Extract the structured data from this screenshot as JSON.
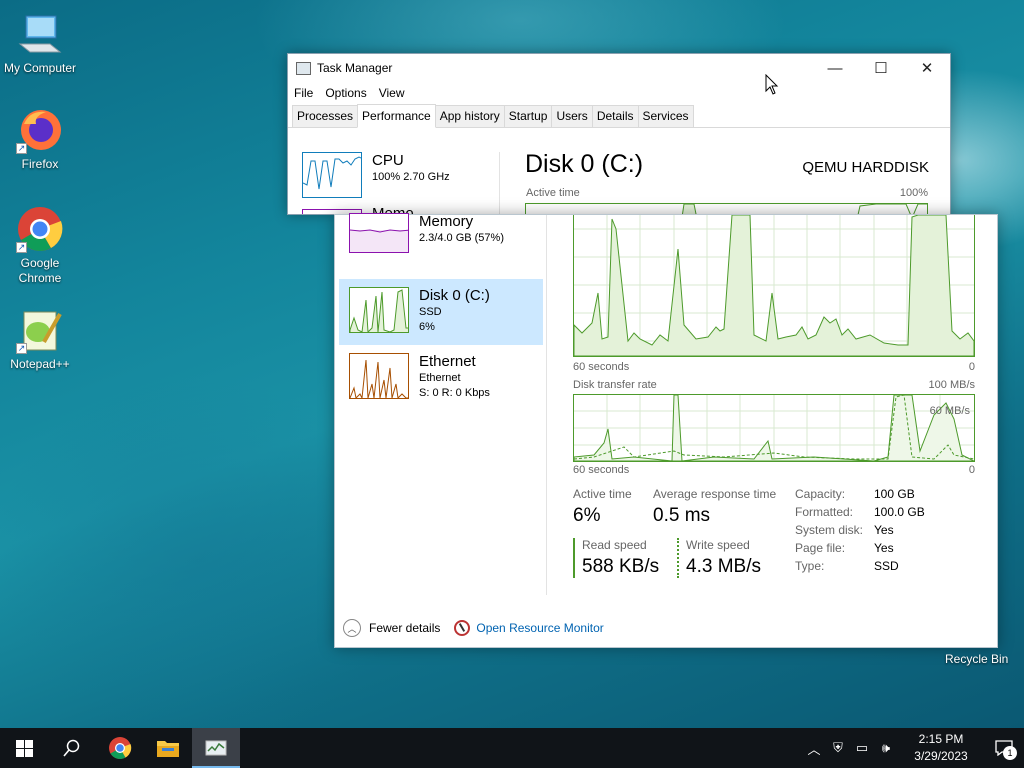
{
  "desktop": {
    "icons": [
      {
        "label": "My Computer"
      },
      {
        "label": "Firefox"
      },
      {
        "label": "Google Chrome"
      },
      {
        "label": "Notepad++"
      }
    ],
    "recycle_bin": "Recycle Bin"
  },
  "window": {
    "title": "Task Manager",
    "controls": {
      "minimize": "—",
      "maximize": "☐",
      "close": "✕"
    },
    "menu": [
      "File",
      "Options",
      "View"
    ],
    "tabs": [
      "Processes",
      "Performance",
      "App history",
      "Startup",
      "Users",
      "Details",
      "Services"
    ],
    "active_tab": "Performance"
  },
  "sidebar": {
    "cpu": {
      "name": "CPU",
      "sub": "100%  2.70 GHz"
    },
    "memory": {
      "name": "Memory",
      "sub": "2.3/4.0 GB (57%)",
      "name_partial": "Memo"
    },
    "disk": {
      "name": "Disk 0 (C:)",
      "sub1": "SSD",
      "sub2": "6%"
    },
    "ethernet": {
      "name": "Ethernet",
      "sub1": "Ethernet",
      "sub2": "S: 0  R: 0 Kbps"
    }
  },
  "detail": {
    "title": "Disk 0 (C:)",
    "model": "QEMU HARDDISK",
    "active_time_chart": {
      "label": "Active time",
      "max": "100%",
      "x_left": "60 seconds",
      "x_right": "0"
    },
    "transfer_chart": {
      "label": "Disk transfer rate",
      "max": "100 MB/s",
      "inline": "60 MB/s",
      "x_left": "60 seconds",
      "x_right": "0"
    },
    "stats": {
      "active_time": {
        "label": "Active time",
        "value": "6%"
      },
      "avg_response": {
        "label": "Average response time",
        "value": "0.5 ms"
      },
      "read_speed": {
        "label": "Read speed",
        "value": "588 KB/s"
      },
      "write_speed": {
        "label": "Write speed",
        "value": "4.3 MB/s"
      }
    },
    "properties": [
      {
        "k": "Capacity:",
        "v": "100 GB"
      },
      {
        "k": "Formatted:",
        "v": "100.0 GB"
      },
      {
        "k": "System disk:",
        "v": "Yes"
      },
      {
        "k": "Page file:",
        "v": "Yes"
      },
      {
        "k": "Type:",
        "v": "SSD"
      }
    ]
  },
  "footer": {
    "fewer": "Fewer details",
    "resource_monitor": "Open Resource Monitor"
  },
  "taskbar": {
    "time": "2:15 PM",
    "date": "3/29/2023",
    "notification_count": "1"
  },
  "colors": {
    "disk": "#4d9a2b",
    "memory": "#8b12ae",
    "network": "#a74f01",
    "selected": "#cce8ff"
  }
}
